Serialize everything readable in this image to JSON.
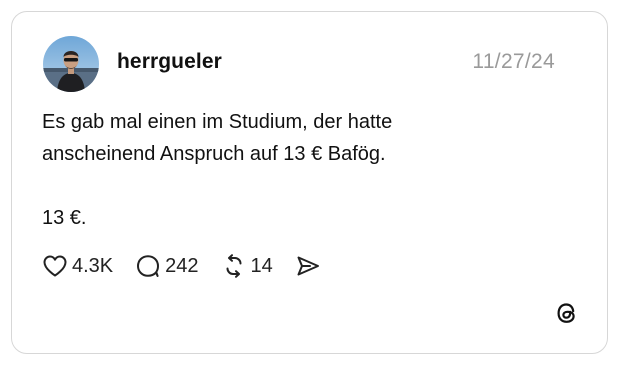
{
  "post": {
    "username": "herrgueler",
    "date": "11/27/24",
    "text": {
      "line1": "Es gab mal einen im Studium, der hatte",
      "line2": "anscheinend Anspruch auf 13 € Bafög.",
      "line3": "13 €."
    },
    "actions": {
      "likes": "4.3K",
      "replies": "242",
      "reposts": "14"
    },
    "icons": {
      "like": "heart-icon",
      "reply": "speech-bubble-icon",
      "repost": "repost-arrows-icon",
      "share": "send-icon",
      "brand": "threads-logo-icon"
    }
  }
}
